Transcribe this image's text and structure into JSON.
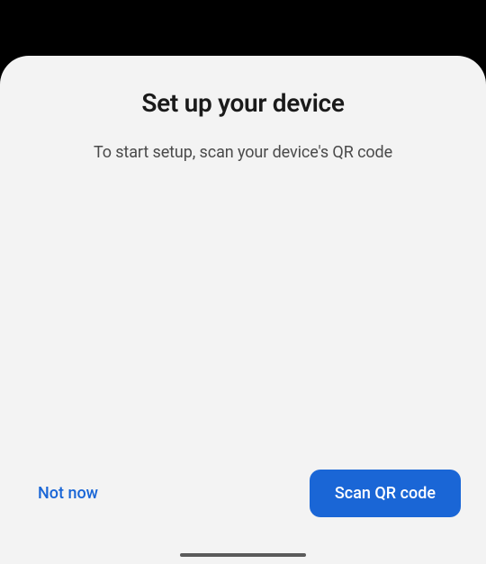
{
  "dialog": {
    "title": "Set up your device",
    "subtitle": "To start setup, scan your device's QR code"
  },
  "buttons": {
    "secondary_label": "Not now",
    "primary_label": "Scan QR code"
  }
}
